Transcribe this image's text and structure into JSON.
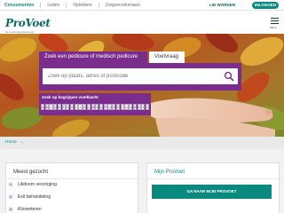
{
  "topnav": {
    "items": [
      "Consumenten",
      "Leden",
      "Opleiders",
      "Zorgverzekeraars"
    ],
    "lid_worden": "LID WORDEN",
    "inloggen": "INLOGGEN"
  },
  "header": {
    "logo_text": "ProVoet",
    "logo_tagline": "de voetzorgprofessional",
    "menu_label": "Menu"
  },
  "search": {
    "tab_main": "Zoek een pedicure of medisch pedicure",
    "tab_alt": "Voetvraag",
    "placeholder": "Zoek op plaats, adres of postcode",
    "verklapper_title": "Zoek op begrippen voetklacht",
    "letters": [
      "A",
      "B",
      "C",
      "D",
      "E",
      "F",
      "G",
      "H",
      "I",
      "J",
      "K",
      "L",
      "M",
      "N",
      "O",
      "P",
      "Q",
      "R",
      "S",
      "T",
      "U",
      "V",
      "W",
      "X",
      "Y",
      "Z"
    ]
  },
  "breadcrumb": {
    "home": "Home",
    "separator": "›"
  },
  "meest_gezocht": {
    "title": "Meest gezocht",
    "items": [
      {
        "num": "1",
        "label": "Likdoorn verzorging"
      },
      {
        "num": "2",
        "label": "Exit behandeling"
      },
      {
        "num": "3",
        "label": "Kloventeren"
      }
    ]
  },
  "mijn_provoet": {
    "title": "Mijn ProVoet",
    "button": "GA NAAR MIJN PROVOET"
  },
  "colors": {
    "brand_teal": "#0a8a7e",
    "brand_purple": "#7a2d8c"
  }
}
